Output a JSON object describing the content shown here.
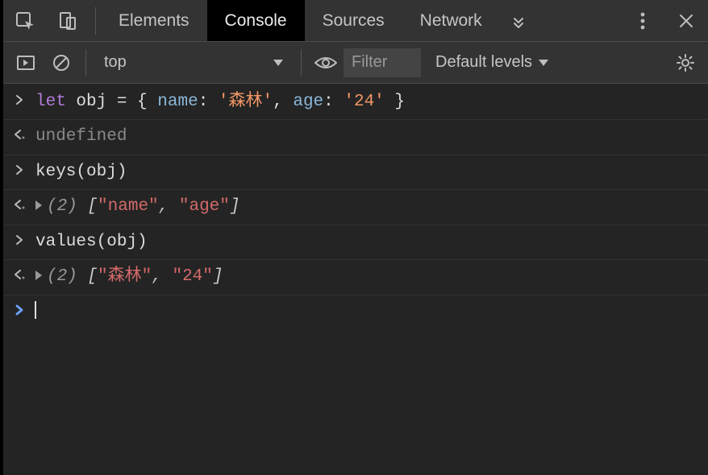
{
  "tabs": {
    "elements": "Elements",
    "console": "Console",
    "sources": "Sources",
    "network": "Network",
    "active": "console"
  },
  "toolbar": {
    "context": "top",
    "filter_placeholder": "Filter",
    "levels": "Default levels"
  },
  "console": {
    "entry1": {
      "let": "let",
      "ident": "obj",
      "eq": " = ",
      "lb": "{ ",
      "k1": "name",
      "c1": ": ",
      "v1": "'森林'",
      "sep": ", ",
      "k2": "age",
      "c2": ": ",
      "v2": "'24'",
      "rb": " }"
    },
    "undef": "undefined",
    "entry2": {
      "call": "keys",
      "lp": "(",
      "arg": "obj",
      "rp": ")"
    },
    "result2": {
      "len": "(2)",
      "lb": " [",
      "a": "\"name\"",
      "sep": ", ",
      "b": "\"age\"",
      "rb": "]"
    },
    "entry3": {
      "call": "values",
      "lp": "(",
      "arg": "obj",
      "rp": ")"
    },
    "result3": {
      "len": "(2)",
      "lb": " [",
      "a": "\"森林\"",
      "sep": ", ",
      "b": "\"24\"",
      "rb": "]"
    }
  }
}
